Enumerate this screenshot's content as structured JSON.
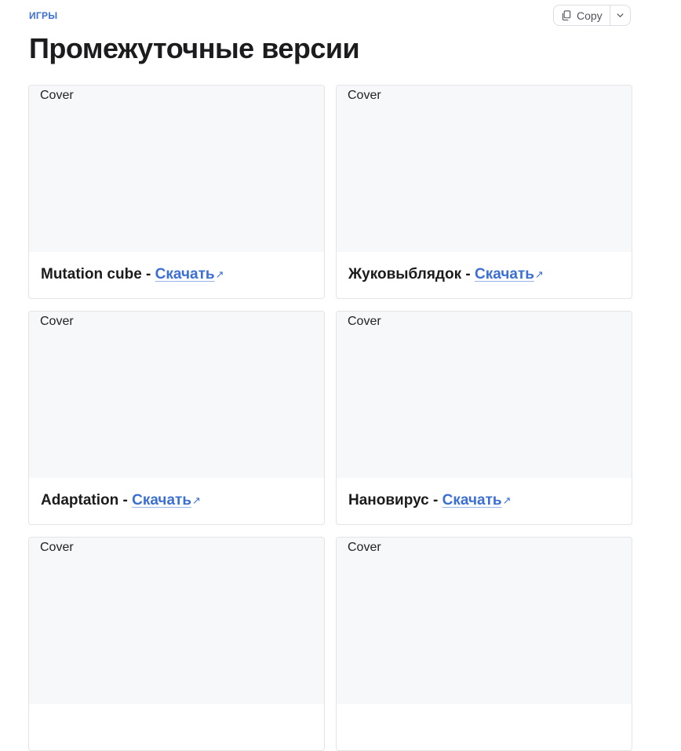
{
  "breadcrumb": "ИГРЫ",
  "page_title": "Промежуточные версии",
  "copy_button": {
    "label": "Copy"
  },
  "cards": [
    {
      "cover_alt": "Cover",
      "title": "Mutation cube",
      "separator": " - ",
      "link_label": "Скачать"
    },
    {
      "cover_alt": "Cover",
      "title": "Жуковыблядок",
      "separator": " - ",
      "link_label": "Скачать"
    },
    {
      "cover_alt": "Cover",
      "title": "Adaptation",
      "separator": " - ",
      "link_label": "Скачать"
    },
    {
      "cover_alt": "Cover",
      "title": "Нановирус",
      "separator": " - ",
      "link_label": "Скачать"
    },
    {
      "cover_alt": "Cover",
      "title": "",
      "separator": "",
      "link_label": ""
    },
    {
      "cover_alt": "Cover",
      "title": "",
      "separator": "",
      "link_label": ""
    }
  ],
  "colors": {
    "accent": "#3b6fd4",
    "cover_bg": "#f7f8fa",
    "border": "#e4e4e7"
  }
}
